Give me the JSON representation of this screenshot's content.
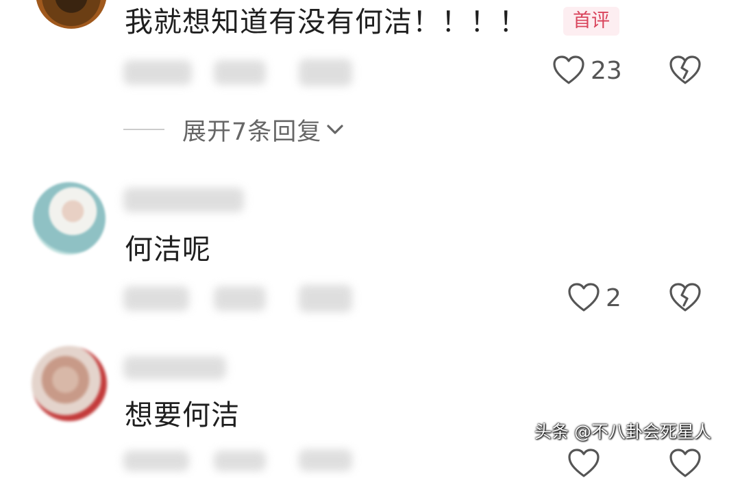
{
  "comments": [
    {
      "text": "我就想知道有没有何洁！！！！",
      "badge": "首评",
      "like_count": "23",
      "expand_label": "展开7条回复"
    },
    {
      "text": "何洁呢",
      "like_count": "2"
    },
    {
      "text": "想要何洁"
    }
  ],
  "watermark": "头条 @不八卦会死星人",
  "icons": [
    "heart-outline",
    "heart-broken-outline",
    "chevron-down"
  ],
  "colors": {
    "badge_text": "#d9445c",
    "badge_bg": "#fdeef1",
    "muted_text": "#666666"
  }
}
